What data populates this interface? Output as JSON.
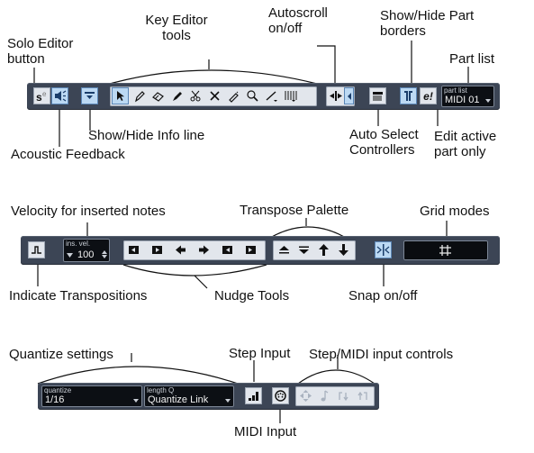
{
  "labels": {
    "key_editor_tools": "Key Editor\ntools",
    "autoscroll": "Autoscroll\non/off",
    "show_hide_part_borders": "Show/Hide Part\nborders",
    "part_list": "Part list",
    "solo_editor_button": "Solo Editor\nbutton",
    "show_hide_info_line": "Show/Hide Info line",
    "auto_select_controllers": "Auto Select\nControllers",
    "edit_active_part_only": "Edit active\npart only",
    "acoustic_feedback": "Acoustic Feedback",
    "velocity_inserted_notes": "Velocity for inserted notes",
    "transpose_palette": "Transpose Palette",
    "grid_modes": "Grid modes",
    "indicate_transpositions": "Indicate Transpositions",
    "nudge_tools": "Nudge Tools",
    "snap_on_off": "Snap on/off",
    "quantize_settings": "Quantize settings",
    "step_input": "Step Input",
    "step_midi_input_controls": "Step/MIDI input controls",
    "midi_input": "MIDI Input"
  },
  "toolbar1": {
    "part_list_title": "part list",
    "part_list_value": "MIDI 01",
    "edit_active_glyph": "e!"
  },
  "toolbar2": {
    "ins_vel_title": "ins. vel.",
    "ins_vel_value": "100"
  },
  "toolbar3": {
    "quantize_title": "quantize",
    "quantize_value": "1/16",
    "length_q_title": "length Q",
    "length_q_value": "Quantize Link"
  },
  "colors": {
    "toolbar_bg": "#3c4555",
    "button_bg": "#e2e6ec",
    "active_blue": "#bcd9f3",
    "field_bg": "#0c0f14"
  }
}
